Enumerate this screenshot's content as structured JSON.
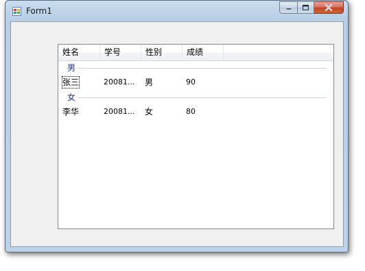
{
  "window": {
    "title": "Form1",
    "icon": "form-app-icon",
    "controls": {
      "minimize": "minimize-icon",
      "maximize": "maximize-icon",
      "close": "close-icon"
    }
  },
  "listview": {
    "columns": [
      "姓名",
      "学号",
      "性别",
      "成绩"
    ],
    "groups": [
      {
        "label": "男",
        "rows": [
          {
            "name": "张三",
            "id": "20081...",
            "gender": "男",
            "score": "90",
            "focused": true
          }
        ]
      },
      {
        "label": "女",
        "rows": [
          {
            "name": "李华",
            "id": "20081...",
            "gender": "女",
            "score": "80",
            "focused": false
          }
        ]
      }
    ]
  },
  "colors": {
    "group_label": "#1e3287",
    "close_button": "#c24426",
    "frame": "#b9cfe6"
  }
}
